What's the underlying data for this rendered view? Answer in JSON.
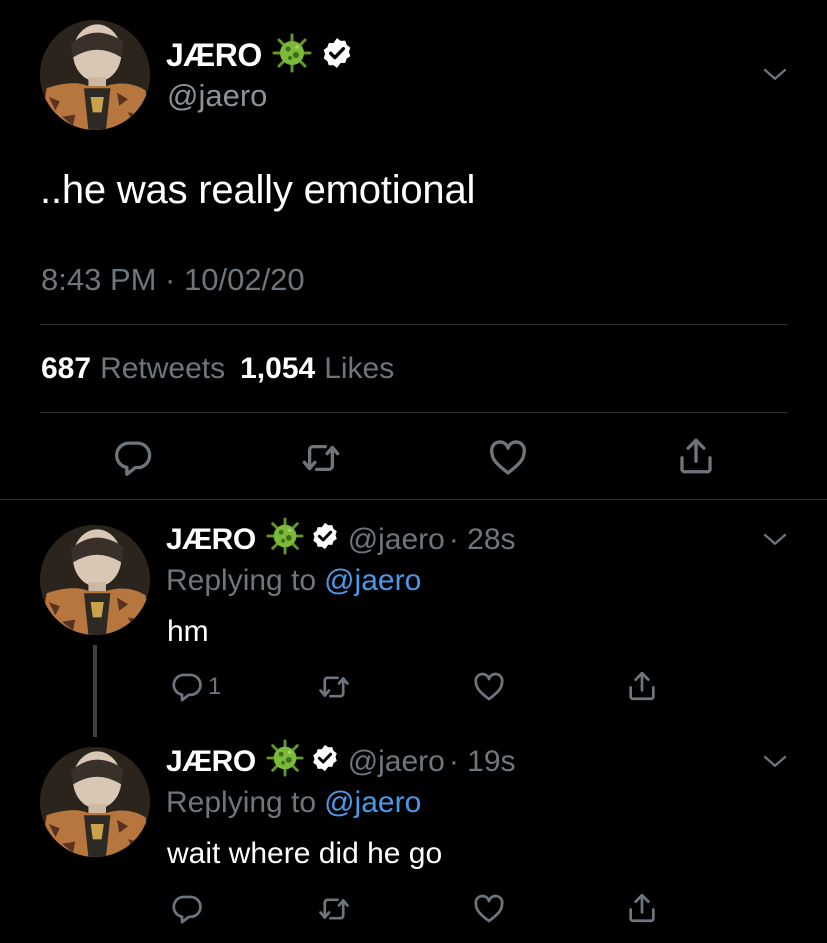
{
  "main_tweet": {
    "display_name": "JÆRO",
    "handle": "@jaero",
    "text": "..he was really emotional",
    "timestamp": "8:43 PM · 10/02/20",
    "retweet_count": "687",
    "retweet_label": "Retweets",
    "like_count": "1,054",
    "like_label": "Likes"
  },
  "replies": [
    {
      "display_name": "JÆRO",
      "handle": "@jaero",
      "time": "· 28s",
      "replying_prefix": "Replying to",
      "replying_handle": "@jaero",
      "text": "hm",
      "reply_count": "1"
    },
    {
      "display_name": "JÆRO",
      "handle": "@jaero",
      "time": "· 19s",
      "replying_prefix": "Replying to",
      "replying_handle": "@jaero",
      "text": "wait where did he go",
      "reply_count": ""
    }
  ],
  "icons": {
    "emoji": "microbe-emoji-icon",
    "verified": "verified-badge-icon",
    "reply": "reply-icon",
    "retweet": "retweet-icon",
    "like": "heart-icon",
    "share": "share-icon",
    "more": "chevron-down-icon"
  },
  "colors": {
    "background": "#000000",
    "text": "#e7e9ea",
    "muted": "#6e767d",
    "link": "#4a99e9",
    "divider": "#2f3336"
  }
}
